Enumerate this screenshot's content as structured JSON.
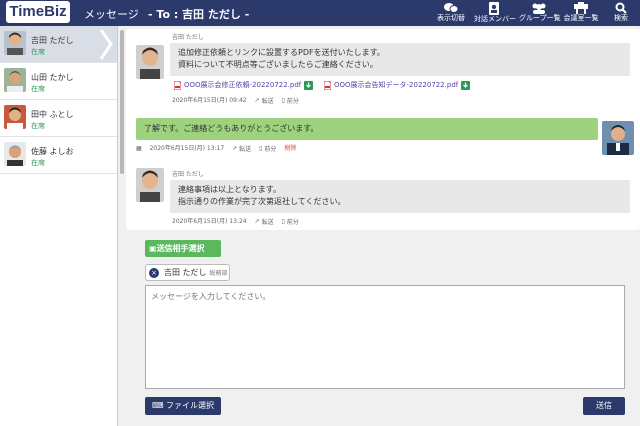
{
  "header": {
    "logo_main": "TimeBiz",
    "title": "メッセージ",
    "to_label": "- To : 吉田 ただし -",
    "buttons": [
      {
        "label": "表示切替",
        "icon": "speech-bubbles-icon"
      },
      {
        "label": "対話メンバー",
        "icon": "member-card-icon"
      },
      {
        "label": "グループ一覧",
        "icon": "group-icon"
      },
      {
        "label": "会議室一覧",
        "icon": "meeting-room-icon"
      },
      {
        "label": "検索",
        "icon": "search-icon"
      }
    ],
    "colors": {
      "bar": "#2b3a6b",
      "logo_accent": "#e07a1f"
    }
  },
  "contacts": [
    {
      "name": "吉田 ただし",
      "status": "在席",
      "active": true
    },
    {
      "name": "山田 たかし",
      "status": "在席",
      "active": false
    },
    {
      "name": "田中 ふとし",
      "status": "在席",
      "active": false
    },
    {
      "name": "佐藤 よしお",
      "status": "在席",
      "active": false
    }
  ],
  "messages": [
    {
      "sender": "吉田 ただし",
      "text_lines": [
        "追加修正依頼とリンクに設置するPDFを送付いたします。",
        "資料について不明点等ございましたらご連絡ください。"
      ],
      "attachments": [
        "OOO展示会修正依頼-20220722.pdf",
        "OOO展示会告知データ-20220722.pdf"
      ],
      "timestamp": "2020年6月15日(月) 09:42",
      "actions": [
        "転送",
        "前分"
      ]
    },
    {
      "sender": "",
      "text_lines": [
        "了解です。ご連絡どうもありがとうございます。"
      ],
      "timestamp": "2020年6月15日(月) 13:17",
      "actions": [
        "転送",
        "前分",
        "削除"
      ]
    },
    {
      "sender": "吉田 ただし",
      "text_lines": [
        "連絡事項は以上となります。",
        "指示通りの作業が完了次第返社してください。"
      ],
      "timestamp": "2020年6月15日(月) 13:24",
      "actions": [
        "転送",
        "前分"
      ]
    }
  ],
  "compose": {
    "recipient_button": "送信相手選択",
    "recipient": {
      "name": "吉田 ただし",
      "dept": "総務部"
    },
    "placeholder": "メッセージを入力してください。",
    "file_button": "ファイル選択",
    "send_button": "送信",
    "colors": {
      "recipient_button": "#5cb85c",
      "primary": "#2b3a6b"
    }
  }
}
